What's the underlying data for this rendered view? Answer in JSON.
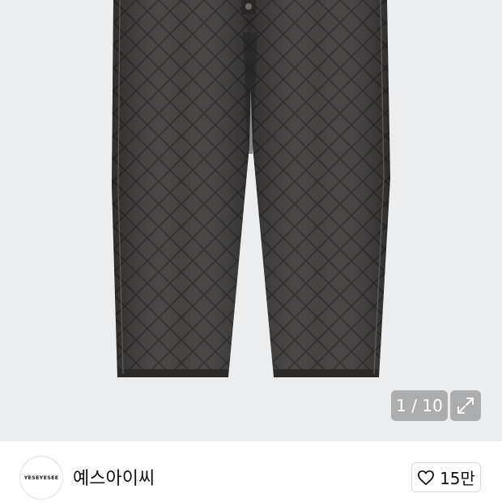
{
  "gallery": {
    "counter": "1 / 10",
    "expand_icon": "expand-icon"
  },
  "brand": {
    "logo_text": "YESEYESEE",
    "name": "예스아이씨"
  },
  "like": {
    "icon": "heart-outline-icon",
    "count": "15만"
  },
  "colors": {
    "background": "#ecedef",
    "denim": "#3b3937",
    "stitch": "#1e1c1b",
    "overlay": "#787878"
  }
}
